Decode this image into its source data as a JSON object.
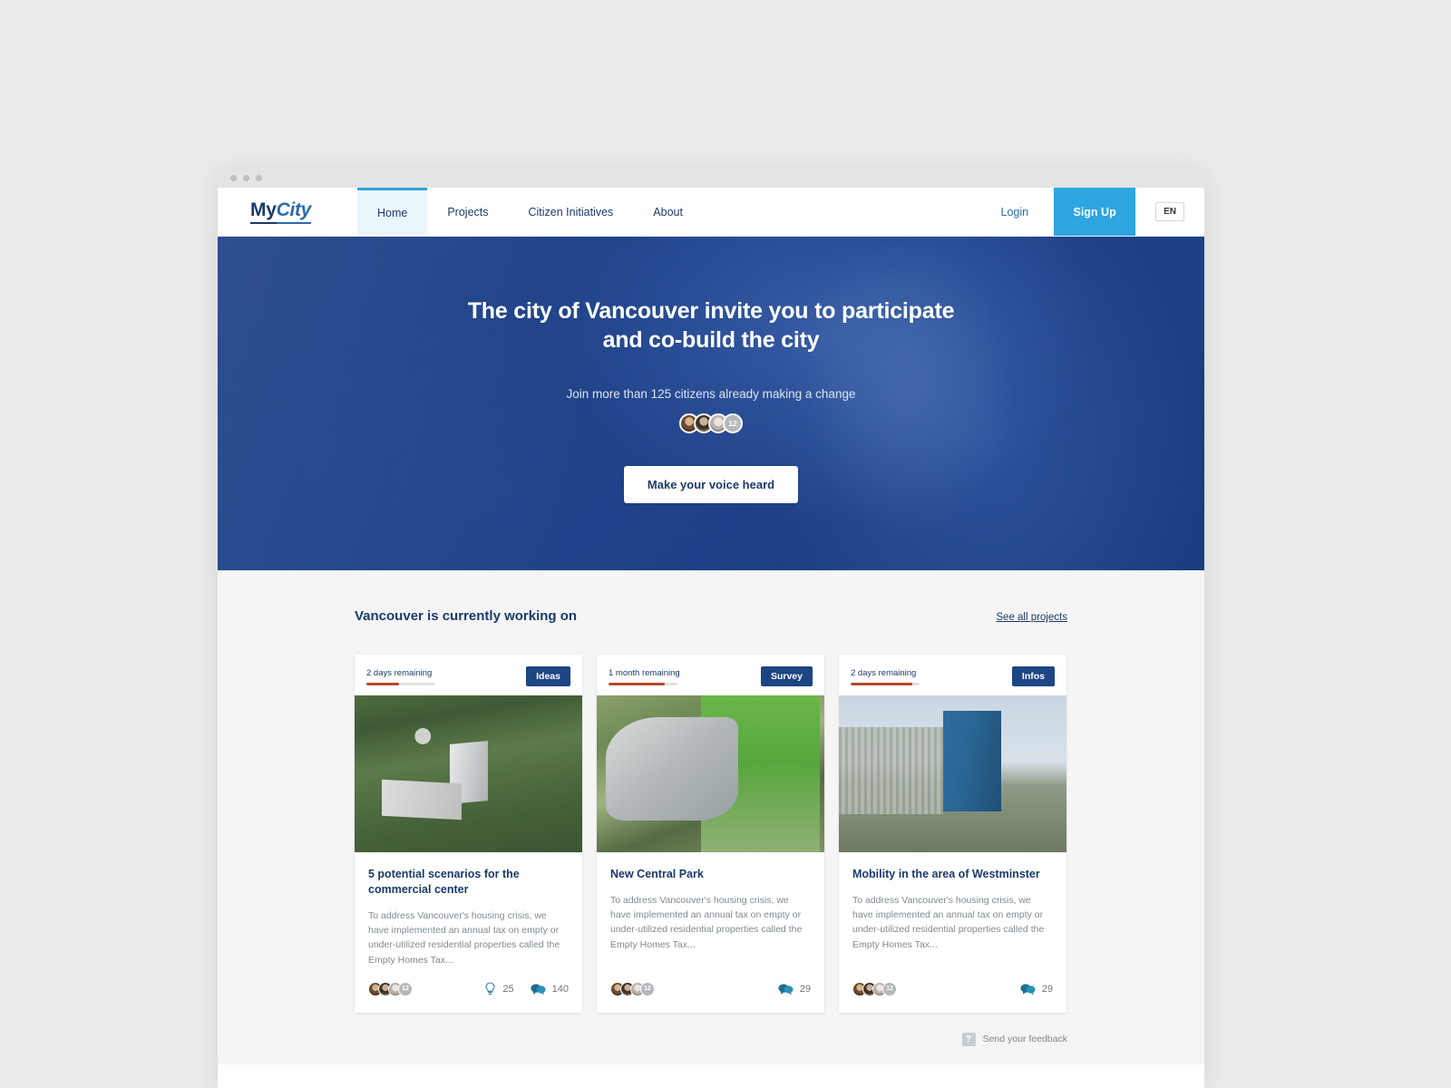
{
  "window": {
    "traffic_lights": [
      "close",
      "minimize",
      "maximize"
    ]
  },
  "navbar": {
    "logo_part1": "My",
    "logo_part2": "City",
    "links": [
      {
        "label": "Home",
        "active": true
      },
      {
        "label": "Projects",
        "active": false
      },
      {
        "label": "Citizen Initiatives",
        "active": false
      },
      {
        "label": "About",
        "active": false
      }
    ],
    "login_label": "Login",
    "signup_label": "Sign Up",
    "language": "EN",
    "accent_color": "#2ca5e0",
    "navy_color": "#1b3a6b"
  },
  "hero": {
    "title": "The city of Vancouver invite you to participate and co-build the city",
    "subtitle": "Join more than 125 citizens already making a change",
    "avatar_more_count": "12",
    "cta_label": "Make your voice heard",
    "background_color": "#1f4287"
  },
  "projects": {
    "section_title": "Vancouver is currently working on",
    "see_all_label": "See all projects",
    "cards": [
      {
        "time_remaining": "2 days remaining",
        "progress_percent": 48,
        "badge": "Ideas",
        "image": "aerial-view-of-commercial-center",
        "title": "5 potential scenarios for the commercial center",
        "description": "To address Vancouver's housing crisis, we have implemented an annual tax on empty or under-utilized residential properties called the Empty Homes Tax...",
        "avatar_more_count": "12",
        "stats": [
          {
            "icon": "lightbulb-icon",
            "value": "25"
          },
          {
            "icon": "comment-icon",
            "value": "140"
          }
        ]
      },
      {
        "time_remaining": "1 month remaining",
        "progress_percent": 82,
        "badge": "Survey",
        "image": "aerial-view-of-park-plaza",
        "title": "New Central Park",
        "description": "To address Vancouver's housing crisis, we have implemented an annual tax on empty or under-utilized residential properties called the Empty Homes Tax...",
        "avatar_more_count": "12",
        "stats": [
          {
            "icon": "comment-icon",
            "value": "29"
          }
        ]
      },
      {
        "time_remaining": "2 days remaining",
        "progress_percent": 90,
        "badge": "Infos",
        "image": "glass-office-tower",
        "title": "Mobility in the area of Westminster",
        "description": "To address Vancouver's housing crisis, we have implemented an annual tax on empty or under-utilized residential properties called the Empty Homes Tax...",
        "avatar_more_count": "12",
        "stats": [
          {
            "icon": "comment-icon",
            "value": "29"
          }
        ]
      }
    ]
  },
  "feedback": {
    "icon": "question-mark-icon",
    "icon_glyph": "?",
    "label": "Send your feedback"
  }
}
